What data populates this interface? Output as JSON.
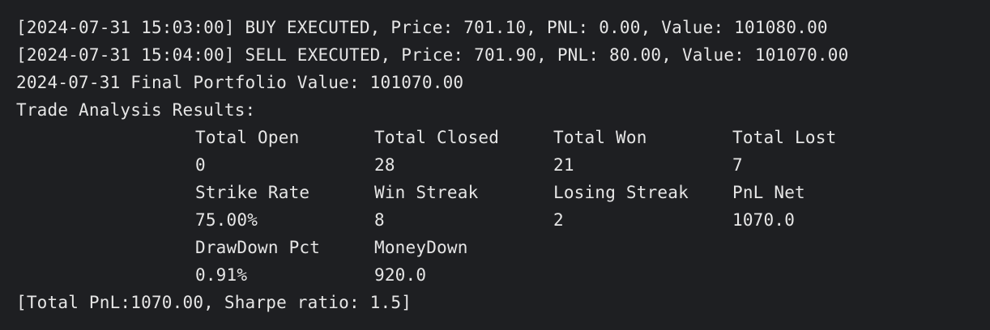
{
  "log": {
    "line1": "[2024-07-31 15:03:00] BUY EXECUTED, Price: 701.10, PNL: 0.00, Value: 101080.00",
    "line2": "[2024-07-31 15:04:00] SELL EXECUTED, Price: 701.90, PNL: 80.00, Value: 101070.00",
    "line3": "2024-07-31 Final Portfolio Value: 101070.00",
    "line4": "Trade Analysis Results:"
  },
  "analysis": {
    "row1": {
      "headers": [
        "Total Open",
        "Total Closed",
        "Total Won",
        "Total Lost"
      ],
      "values": [
        "0",
        "28",
        "21",
        "7"
      ]
    },
    "row2": {
      "headers": [
        "Strike Rate",
        "Win Streak",
        "Losing Streak",
        "PnL Net"
      ],
      "values": [
        "75.00%",
        "8",
        "2",
        "1070.0"
      ]
    },
    "row3": {
      "headers": [
        "DrawDown Pct",
        "MoneyDown"
      ],
      "values": [
        "0.91%",
        "920.0"
      ]
    }
  },
  "summary": "[Total PnL:1070.00, Sharpe ratio: 1.5]"
}
